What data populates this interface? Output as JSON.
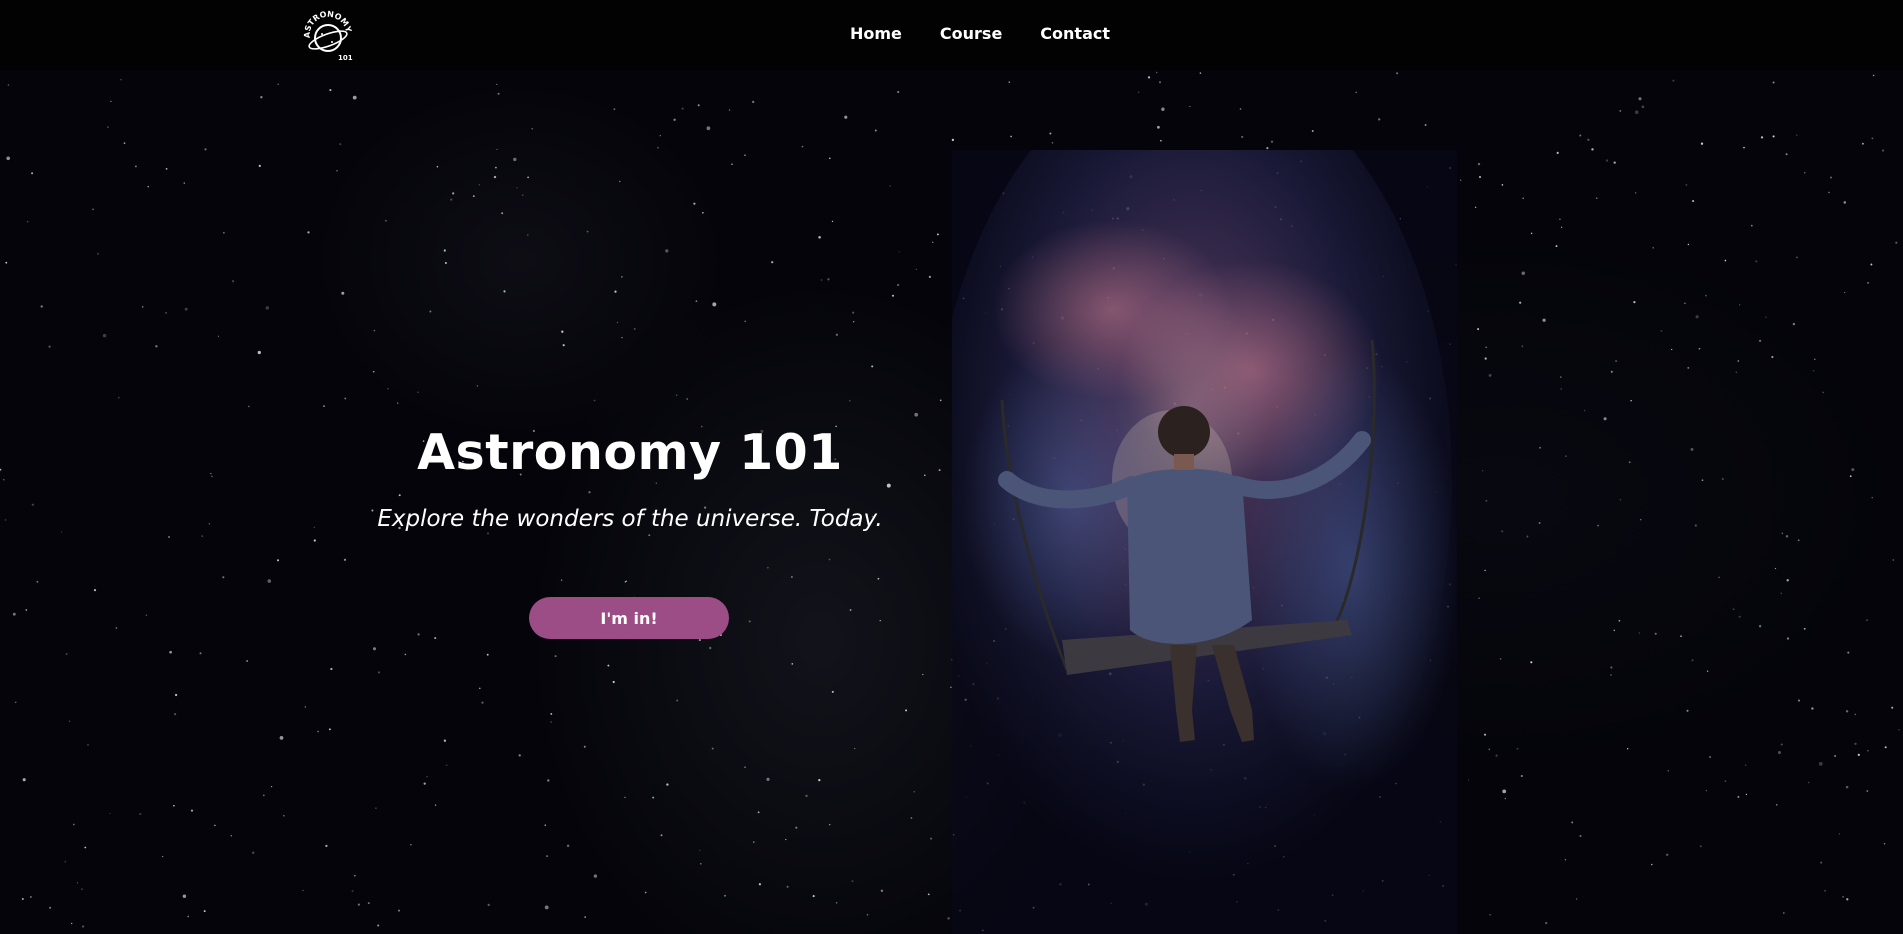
{
  "nav": {
    "logo_alt": "Astronomy 101 logo",
    "logo_text_top": "ASTRONOMY",
    "logo_text_bottom": "101",
    "links": [
      {
        "label": "Home"
      },
      {
        "label": "Course"
      },
      {
        "label": "Contact"
      }
    ]
  },
  "hero": {
    "title": "Astronomy 101",
    "subtitle": "Explore the wonders of the universe. Today.",
    "cta_label": "I'm in!",
    "image_alt": "Woman on a swing in front of a galaxy"
  },
  "colors": {
    "background": "#04040a",
    "navbar": "#020202",
    "accent": "#9d4d85",
    "text": "#ffffff"
  },
  "icons": {
    "logo": "planet-logo-icon"
  }
}
